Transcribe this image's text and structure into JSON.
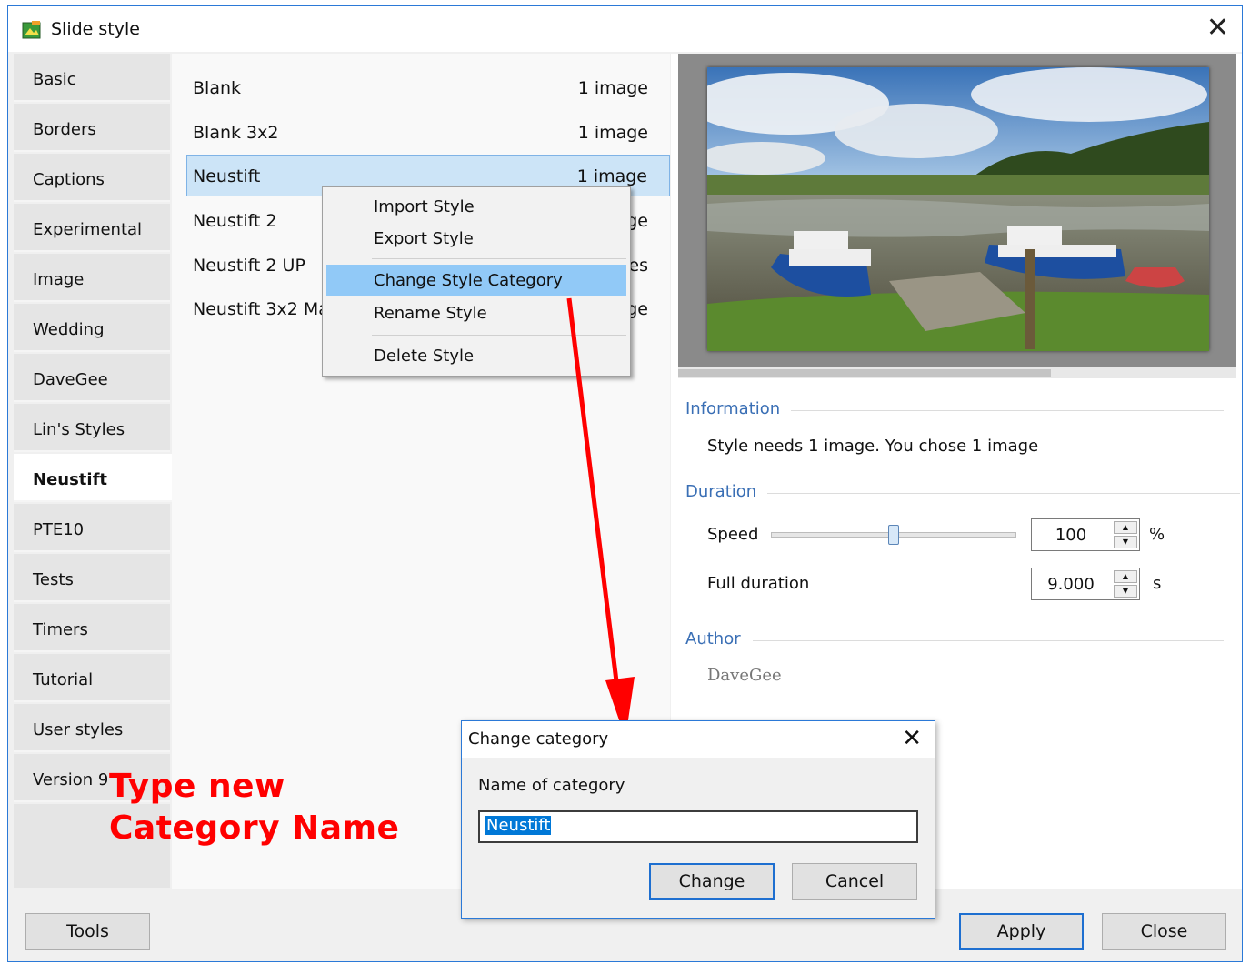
{
  "window": {
    "title": "Slide style",
    "close_label": "✕"
  },
  "tabs": [
    {
      "label": "Basic"
    },
    {
      "label": "Borders"
    },
    {
      "label": "Captions"
    },
    {
      "label": "Experimental"
    },
    {
      "label": "Image"
    },
    {
      "label": "Wedding"
    },
    {
      "label": "DaveGee"
    },
    {
      "label": "Lin's Styles"
    },
    {
      "label": "Neustift",
      "active": true
    },
    {
      "label": "PTE10"
    },
    {
      "label": "Tests"
    },
    {
      "label": "Timers"
    },
    {
      "label": "Tutorial"
    },
    {
      "label": "User styles"
    },
    {
      "label": "Version 9"
    }
  ],
  "styles": [
    {
      "name": "Blank",
      "count": "1 image"
    },
    {
      "name": "Blank 3x2",
      "count": "1 image"
    },
    {
      "name": "Neustift",
      "count": "1 image",
      "selected": true
    },
    {
      "name": "Neustift 2",
      "count": "1 image"
    },
    {
      "name": "Neustift 2 UP",
      "count": "2 images"
    },
    {
      "name": "Neustift 3x2 Ma",
      "count": "1 image"
    }
  ],
  "context_menu": {
    "items": [
      {
        "label": "Import Style"
      },
      {
        "label": "Export Style"
      },
      {
        "label": "Change Style Category",
        "highlighted": true
      },
      {
        "label": "Rename Style"
      },
      {
        "label": "Delete Style"
      }
    ]
  },
  "information": {
    "title": "Information",
    "text": "Style needs 1 image. You chose 1 image"
  },
  "duration": {
    "title": "Duration",
    "speed_label": "Speed",
    "speed_value": "100",
    "speed_unit": "%",
    "full_label": "Full duration",
    "full_value": "9.000",
    "full_unit": "s",
    "speed_position": 0.5
  },
  "author": {
    "title": "Author",
    "name": "DaveGee"
  },
  "buttons": {
    "tools": "Tools",
    "apply": "Apply",
    "close": "Close"
  },
  "dialog": {
    "title": "Change category",
    "close_label": "✕",
    "label": "Name of category",
    "input_value": "Neustift",
    "change": "Change",
    "cancel": "Cancel"
  },
  "annotation": {
    "line1": "Type new",
    "line2": "Category Name"
  },
  "colors": {
    "accent": "#2b79d7",
    "selection": "#cce4f7",
    "menu_highlight": "#91c9f7",
    "annotation": "#ff0000",
    "section_title": "#3a6fb5"
  },
  "icons": {
    "app": "slide-style-app-icon",
    "close": "close-icon"
  }
}
